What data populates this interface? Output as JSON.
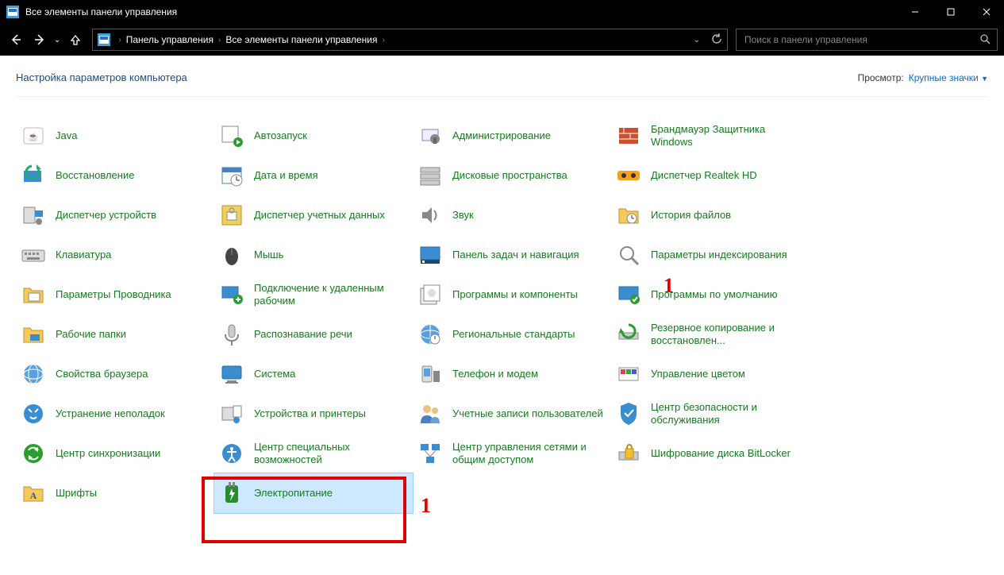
{
  "window": {
    "title": "Все элементы панели управления"
  },
  "address": {
    "seg1": "Панель управления",
    "seg2": "Все элементы панели управления"
  },
  "search": {
    "placeholder": "Поиск в панели управления"
  },
  "header": {
    "title": "Настройка параметров компьютера",
    "view_label": "Просмотр:",
    "view_value": "Крупные значки"
  },
  "items": [
    {
      "label": "Java",
      "icon": "java"
    },
    {
      "label": "Автозапуск",
      "icon": "autoplay"
    },
    {
      "label": "Администрирование",
      "icon": "admin"
    },
    {
      "label": "Брандмауэр Защитника Windows",
      "icon": "firewall"
    },
    {
      "label": "Восстановление",
      "icon": "recovery"
    },
    {
      "label": "Дата и время",
      "icon": "datetime"
    },
    {
      "label": "Дисковые пространства",
      "icon": "disks"
    },
    {
      "label": "Диспетчер Realtek HD",
      "icon": "realtek"
    },
    {
      "label": "Диспетчер устройств",
      "icon": "devicemgr"
    },
    {
      "label": "Диспетчер учетных данных",
      "icon": "credmgr"
    },
    {
      "label": "Звук",
      "icon": "sound"
    },
    {
      "label": "История файлов",
      "icon": "filehistory"
    },
    {
      "label": "Клавиатура",
      "icon": "keyboard"
    },
    {
      "label": "Мышь",
      "icon": "mouse"
    },
    {
      "label": "Панель задач и навигация",
      "icon": "taskbar"
    },
    {
      "label": "Параметры индексирования",
      "icon": "indexing"
    },
    {
      "label": "Параметры Проводника",
      "icon": "explorer"
    },
    {
      "label": "Подключение к удаленным рабочим",
      "icon": "remote"
    },
    {
      "label": "Программы и компоненты",
      "icon": "programs"
    },
    {
      "label": "Программы по умолчанию",
      "icon": "defaults"
    },
    {
      "label": "Рабочие папки",
      "icon": "workfolders"
    },
    {
      "label": "Распознавание речи",
      "icon": "speech"
    },
    {
      "label": "Региональные стандарты",
      "icon": "region"
    },
    {
      "label": "Резервное копирование и восстановлен...",
      "icon": "backup"
    },
    {
      "label": "Свойства браузера",
      "icon": "inetopts"
    },
    {
      "label": "Система",
      "icon": "system"
    },
    {
      "label": "Телефон и модем",
      "icon": "phone"
    },
    {
      "label": "Управление цветом",
      "icon": "color"
    },
    {
      "label": "Устранение неполадок",
      "icon": "troubleshoot"
    },
    {
      "label": "Устройства и принтеры",
      "icon": "devices"
    },
    {
      "label": "Учетные записи пользователей",
      "icon": "users"
    },
    {
      "label": "Центр безопасности и обслуживания",
      "icon": "security"
    },
    {
      "label": "Центр синхронизации",
      "icon": "sync"
    },
    {
      "label": "Центр специальных возможностей",
      "icon": "ease"
    },
    {
      "label": "Центр управления сетями и общим доступом",
      "icon": "network"
    },
    {
      "label": "Шифрование диска BitLocker",
      "icon": "bitlocker"
    },
    {
      "label": "Шрифты",
      "icon": "fonts"
    },
    {
      "label": "Электропитание",
      "icon": "power",
      "selected": true
    }
  ],
  "annotations": {
    "marker": "1"
  }
}
